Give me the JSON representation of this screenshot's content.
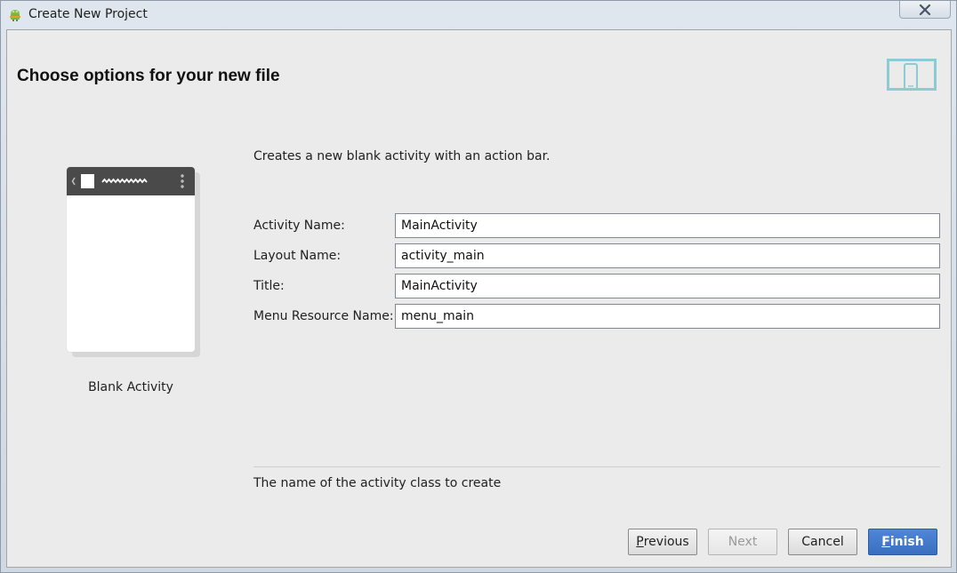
{
  "window": {
    "title": "Create New Project"
  },
  "header": {
    "heading": "Choose options for your new file"
  },
  "preview": {
    "label": "Blank Activity"
  },
  "description": "Creates a new blank activity with an action bar.",
  "form": {
    "activity_name": {
      "label": "Activity Name:",
      "value": "MainActivity"
    },
    "layout_name": {
      "label": "Layout Name:",
      "value": "activity_main"
    },
    "title": {
      "label": "Title:",
      "value": "MainActivity"
    },
    "menu_resource_name": {
      "label": "Menu Resource Name:",
      "value": "menu_main"
    }
  },
  "hint": "The name of the activity class to create",
  "buttons": {
    "previous": {
      "mnemonic": "P",
      "rest": "revious"
    },
    "next": {
      "label": "Next"
    },
    "cancel": {
      "label": "Cancel"
    },
    "finish": {
      "mnemonic": "F",
      "rest": "inish"
    }
  },
  "colors": {
    "accent": "#3a6fc0",
    "action_bar": "#4a4a4a",
    "icon_teal": "#8ccbd3"
  }
}
